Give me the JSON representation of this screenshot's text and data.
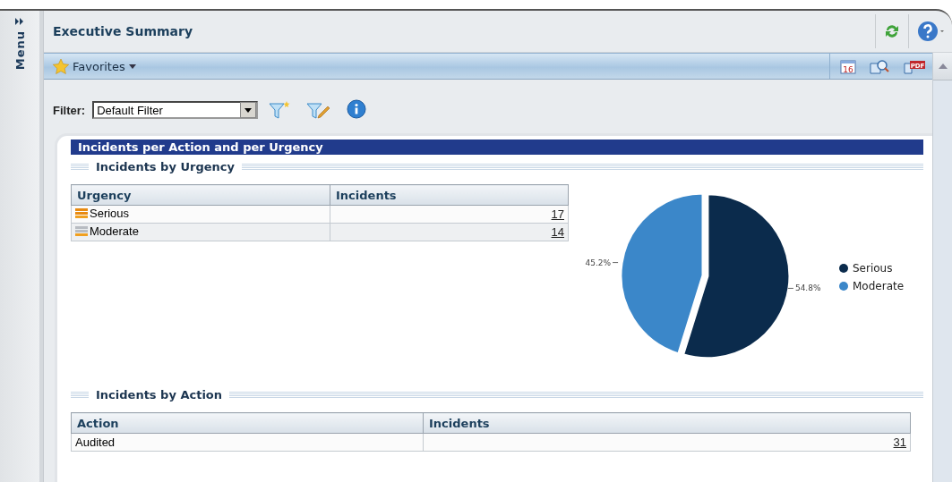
{
  "sidebar": {
    "label": "Menu"
  },
  "header": {
    "title": "Executive Summary"
  },
  "toolbar": {
    "favorites": "Favorites",
    "tools": [
      {
        "kind": "calendar",
        "label": "16"
      },
      {
        "kind": "preview"
      },
      {
        "kind": "pdf",
        "label": "PDF"
      }
    ]
  },
  "filter": {
    "label": "Filter:",
    "value": "Default Filter"
  },
  "report": {
    "title": "Incidents per Action and per Urgency",
    "urgency_section": {
      "title": "Incidents by Urgency",
      "columns": [
        "Urgency",
        "Incidents"
      ],
      "rows": [
        {
          "kind": "serious",
          "urgency": "Serious",
          "incidents": "17"
        },
        {
          "kind": "moderate",
          "urgency": "Moderate",
          "incidents": "14"
        }
      ],
      "chart_data": {
        "type": "pie",
        "categories": [
          "Serious",
          "Moderate"
        ],
        "legend": "right",
        "series": [
          {
            "colors": [
              "#0b2b4c",
              "#3b87c9"
            ],
            "values": [
              54.8,
              45.2
            ]
          }
        ],
        "value_labels": [
          "54.8%",
          "45.2%"
        ]
      }
    },
    "action_section": {
      "title": "Incidents by Action",
      "columns": [
        "Action",
        "Incidents"
      ],
      "rows": [
        {
          "action": "Audited",
          "incidents": "31"
        }
      ]
    }
  }
}
